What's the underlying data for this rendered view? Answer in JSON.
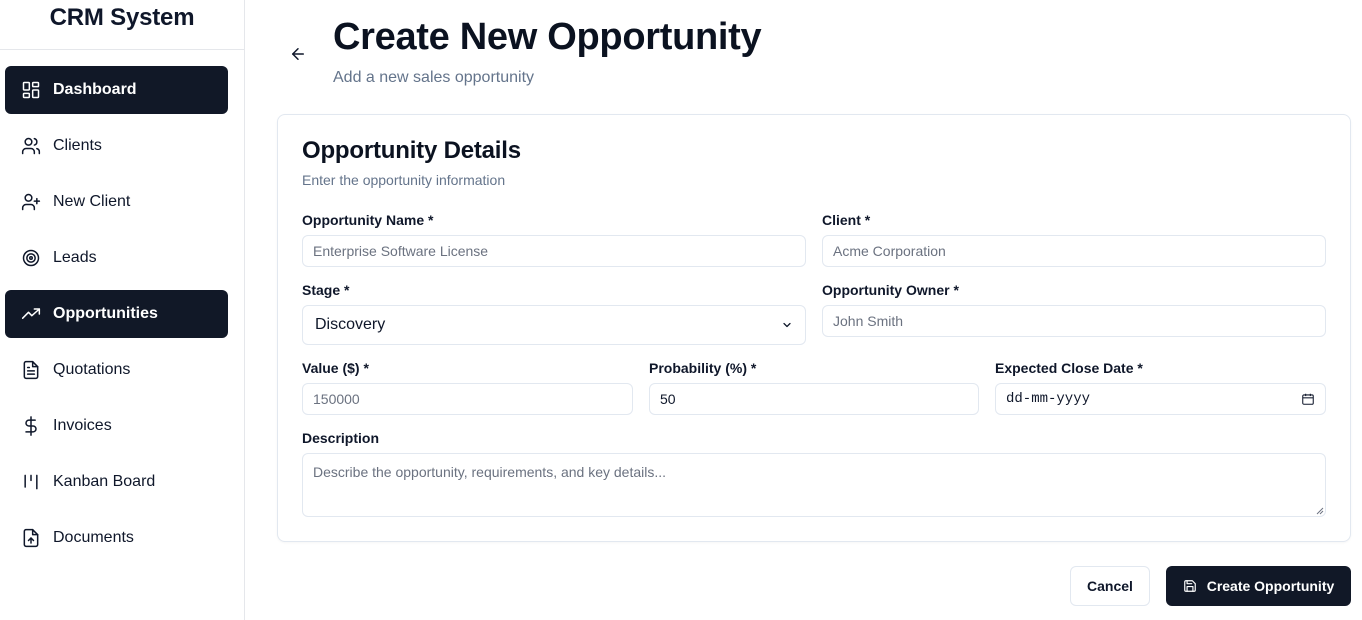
{
  "sidebar": {
    "brand": "CRM System",
    "items": [
      {
        "label": "Dashboard",
        "icon": "dashboard-icon",
        "active": true
      },
      {
        "label": "Clients",
        "icon": "users-icon",
        "active": false
      },
      {
        "label": "New Client",
        "icon": "user-plus-icon",
        "active": false
      },
      {
        "label": "Leads",
        "icon": "target-icon",
        "active": false
      },
      {
        "label": "Opportunities",
        "icon": "trending-up-icon",
        "active": true
      },
      {
        "label": "Quotations",
        "icon": "file-text-icon",
        "active": false
      },
      {
        "label": "Invoices",
        "icon": "dollar-icon",
        "active": false
      },
      {
        "label": "Kanban Board",
        "icon": "kanban-icon",
        "active": false
      },
      {
        "label": "Documents",
        "icon": "file-upload-icon",
        "active": false
      }
    ]
  },
  "header": {
    "title": "Create New Opportunity",
    "subtitle": "Add a new sales opportunity"
  },
  "card": {
    "title": "Opportunity Details",
    "description": "Enter the opportunity information"
  },
  "form": {
    "opportunity_name": {
      "label": "Opportunity Name *",
      "placeholder": "Enterprise Software License",
      "value": ""
    },
    "client": {
      "label": "Client *",
      "placeholder": "Acme Corporation",
      "value": ""
    },
    "stage": {
      "label": "Stage *",
      "value": "Discovery"
    },
    "owner": {
      "label": "Opportunity Owner *",
      "placeholder": "John Smith",
      "value": ""
    },
    "value": {
      "label": "Value ($) *",
      "placeholder": "150000",
      "value": ""
    },
    "probability": {
      "label": "Probability (%) *",
      "value": "50"
    },
    "close_date": {
      "label": "Expected Close Date *",
      "placeholder": "dd-mm-yyyy"
    },
    "description": {
      "label": "Description",
      "placeholder": "Describe the opportunity, requirements, and key details..."
    }
  },
  "actions": {
    "cancel": "Cancel",
    "submit": "Create Opportunity"
  },
  "colors": {
    "primary": "#111827",
    "muted_text": "#64748b",
    "border": "#e2e8f0"
  }
}
